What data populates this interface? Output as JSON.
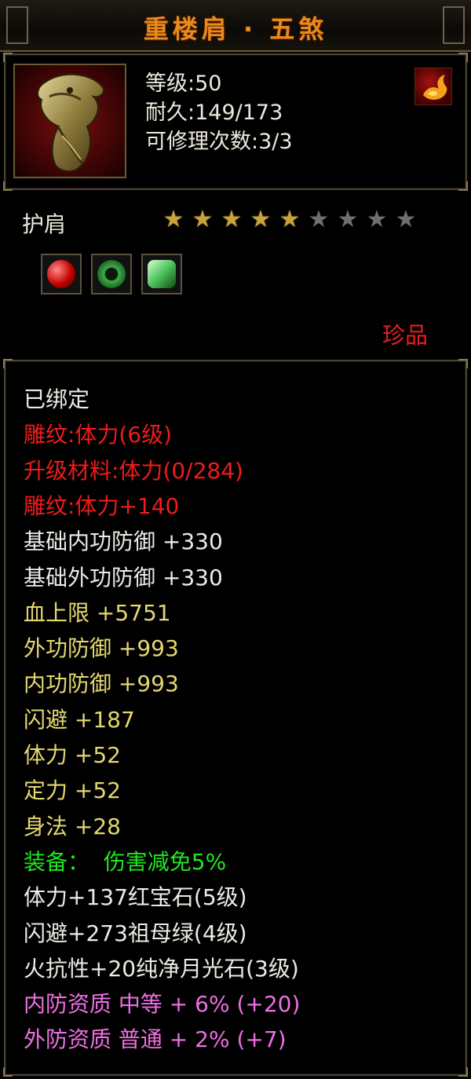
{
  "title": "重楼肩 · 五煞",
  "item": {
    "icon": "dragon-shoulder-armor",
    "stats": [
      {
        "label": "等级",
        "value": "50"
      },
      {
        "label": "耐久",
        "value": "149/173"
      },
      {
        "label": "可修理次数",
        "value": "3/3"
      }
    ],
    "school_badge": "flame-swirl-icon",
    "type": "护肩",
    "stars": {
      "filled": 5,
      "total": 9
    },
    "gems": [
      "ruby-gem-icon",
      "emerald-ring-icon",
      "moonstone-gem-icon"
    ],
    "rarity": "珍品"
  },
  "properties": [
    {
      "text": "已绑定",
      "color": "white"
    },
    {
      "text": "雕纹:体力(6级)",
      "color": "red"
    },
    {
      "text": "升级材料:体力(0/284)",
      "color": "red"
    },
    {
      "text": "雕纹:体力+140",
      "color": "red"
    },
    {
      "text": "基础内功防御 +330",
      "color": "white"
    },
    {
      "text": "基础外功防御 +330",
      "color": "white"
    },
    {
      "text": "血上限 +5751",
      "color": "yellow"
    },
    {
      "text": "外功防御 +993",
      "color": "yellow"
    },
    {
      "text": "内功防御 +993",
      "color": "yellow"
    },
    {
      "text": "闪避 +187",
      "color": "yellow"
    },
    {
      "text": "体力 +52",
      "color": "yellow"
    },
    {
      "text": "定力 +52",
      "color": "yellow"
    },
    {
      "text": "身法 +28",
      "color": "yellow"
    },
    {
      "text": "装备：  伤害减免5%",
      "color": "green"
    },
    {
      "text": "体力+137红宝石(5级)",
      "color": "white"
    },
    {
      "text": "闪避+273祖母绿(4级)",
      "color": "white"
    },
    {
      "text": "火抗性+20纯净月光石(3级)",
      "color": "white"
    },
    {
      "text": "内防资质 中等 + 6% (+20)",
      "color": "pink"
    },
    {
      "text": "外防资质 普通 + 2% (+7)",
      "color": "pink"
    }
  ]
}
